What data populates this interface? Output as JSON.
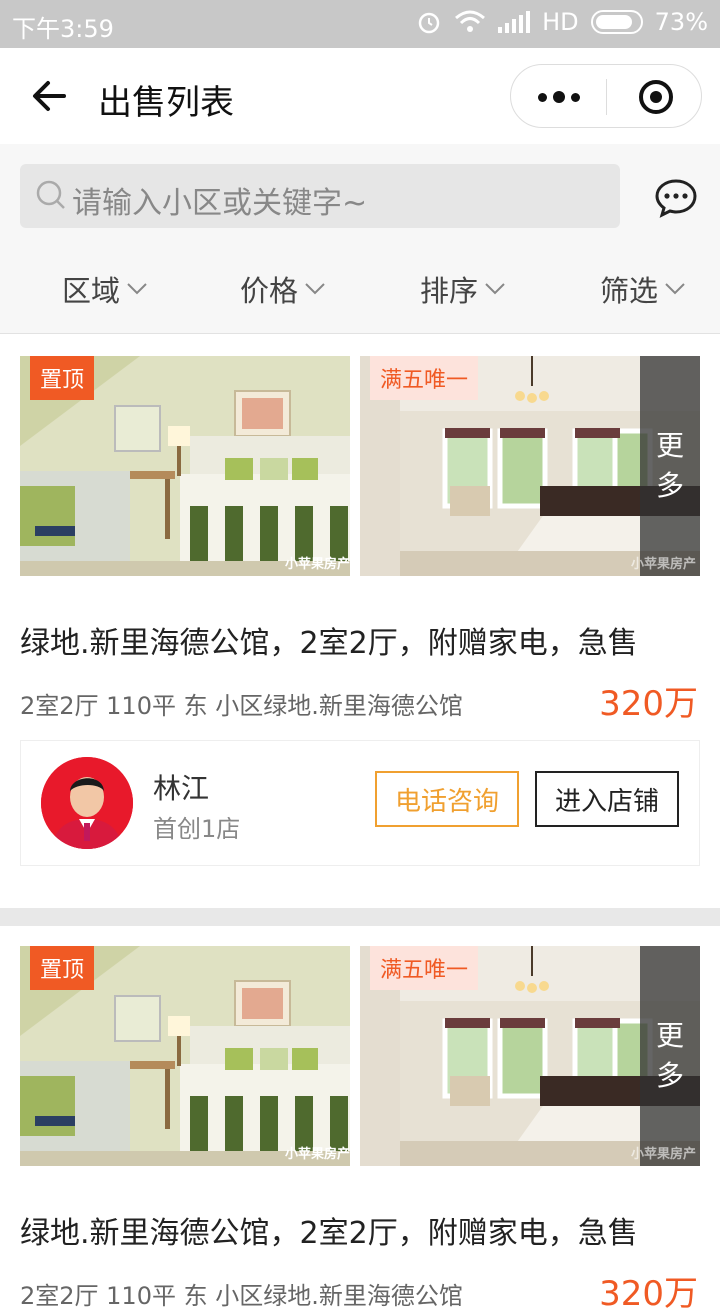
{
  "status_bar": {
    "time": "下午3:59",
    "network": "HD",
    "battery": "73%"
  },
  "nav": {
    "title": "出售列表"
  },
  "search": {
    "placeholder": "请输入小区或关键字~"
  },
  "filters": [
    "区域",
    "价格",
    "排序",
    "筛选"
  ],
  "listings": [
    {
      "tag_top": "置顶",
      "tag_feature": "满五唯一",
      "watermark": "小苹果房产",
      "more": "更多",
      "more_line1": "更",
      "more_line2": "多",
      "title": "绿地.新里海德公馆，2室2厅，附赠家电，急售",
      "info": "2室2厅 110平 东 小区绿地.新里海德公馆",
      "price": "320万",
      "agent_name": "林江",
      "agent_store": "首创1店",
      "call_label": "电话咨询",
      "shop_label": "进入店铺"
    },
    {
      "tag_top": "置顶",
      "tag_feature": "满五唯一",
      "watermark": "小苹果房产",
      "more": "更多",
      "more_line1": "更",
      "more_line2": "多",
      "title": "绿地.新里海德公馆，2室2厅，附赠家电，急售",
      "info": "2室2厅 110平 东 小区绿地.新里海德公馆",
      "price": "320万"
    }
  ],
  "colors": {
    "accent": "#f05a24",
    "call_border": "#f0a030",
    "status_bar": "#c8c8c8",
    "search_bg": "#e6e6e6"
  }
}
